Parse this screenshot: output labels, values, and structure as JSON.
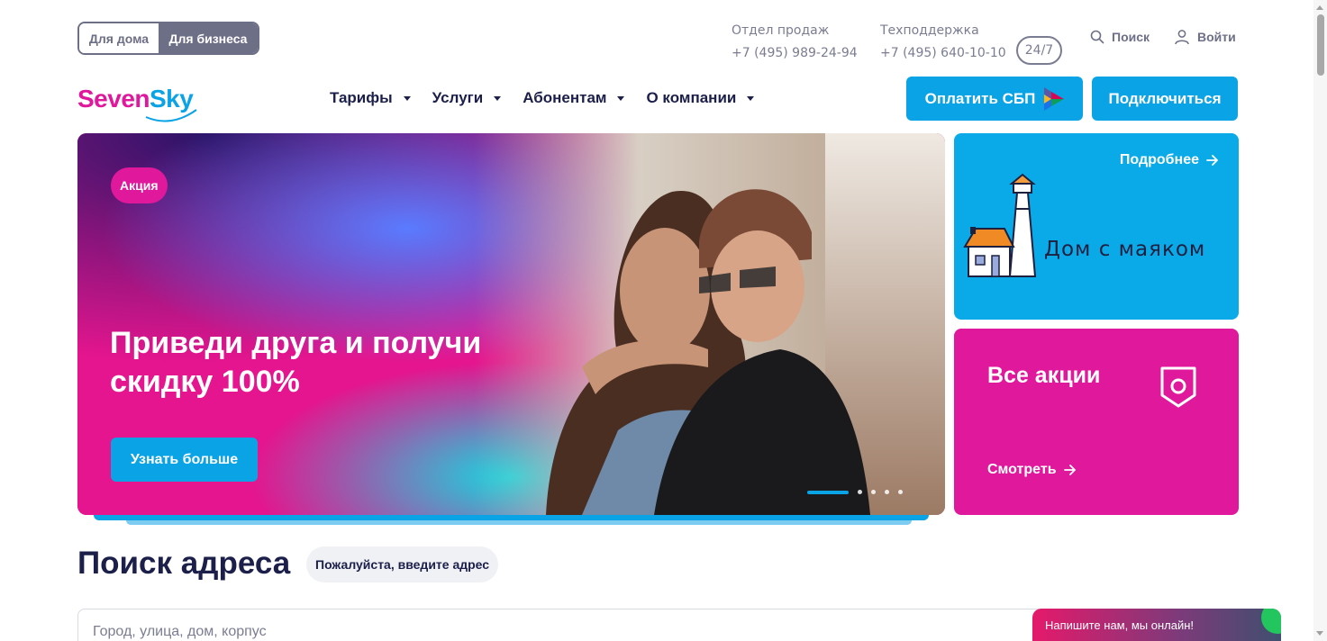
{
  "segment": {
    "home": "Для дома",
    "business": "Для бизнеса"
  },
  "contacts": {
    "sales_label": "Отдел продаж",
    "sales_phone": "+7 (495) 989-24-94",
    "support_label": "Техподдержка",
    "support_phone": "+7 (495) 640-10-10",
    "support_badge": "24/7"
  },
  "top_links": {
    "search": "Поиск",
    "login": "Войти"
  },
  "logo": {
    "part1": "Seven",
    "part2": "Sky"
  },
  "nav": [
    {
      "label": "Тарифы"
    },
    {
      "label": "Услуги"
    },
    {
      "label": "Абонентам"
    },
    {
      "label": "О компании"
    }
  ],
  "header_buttons": {
    "pay": "Оплатить СБП",
    "connect": "Подключиться"
  },
  "hero": {
    "tag": "Акция",
    "title": "Приведи друга и получи скидку 100%",
    "button": "Узнать больше",
    "slides_total": 5,
    "slide_active": 1
  },
  "card_lighthouse": {
    "link": "Подробнее",
    "logo_text": "Дом с маяком"
  },
  "card_promos": {
    "title": "Все акции",
    "link": "Смотреть"
  },
  "address": {
    "title": "Поиск адреса",
    "hint": "Пожалуйста, введите адрес",
    "placeholder": "Город, улица, дом, корпус"
  },
  "chat": {
    "text": "Напишите нам, мы онлайн!"
  },
  "colors": {
    "magenta": "#e0189c",
    "blue": "#0aa3e6",
    "navy": "#1b1f4a",
    "gray": "#6c6f86"
  }
}
